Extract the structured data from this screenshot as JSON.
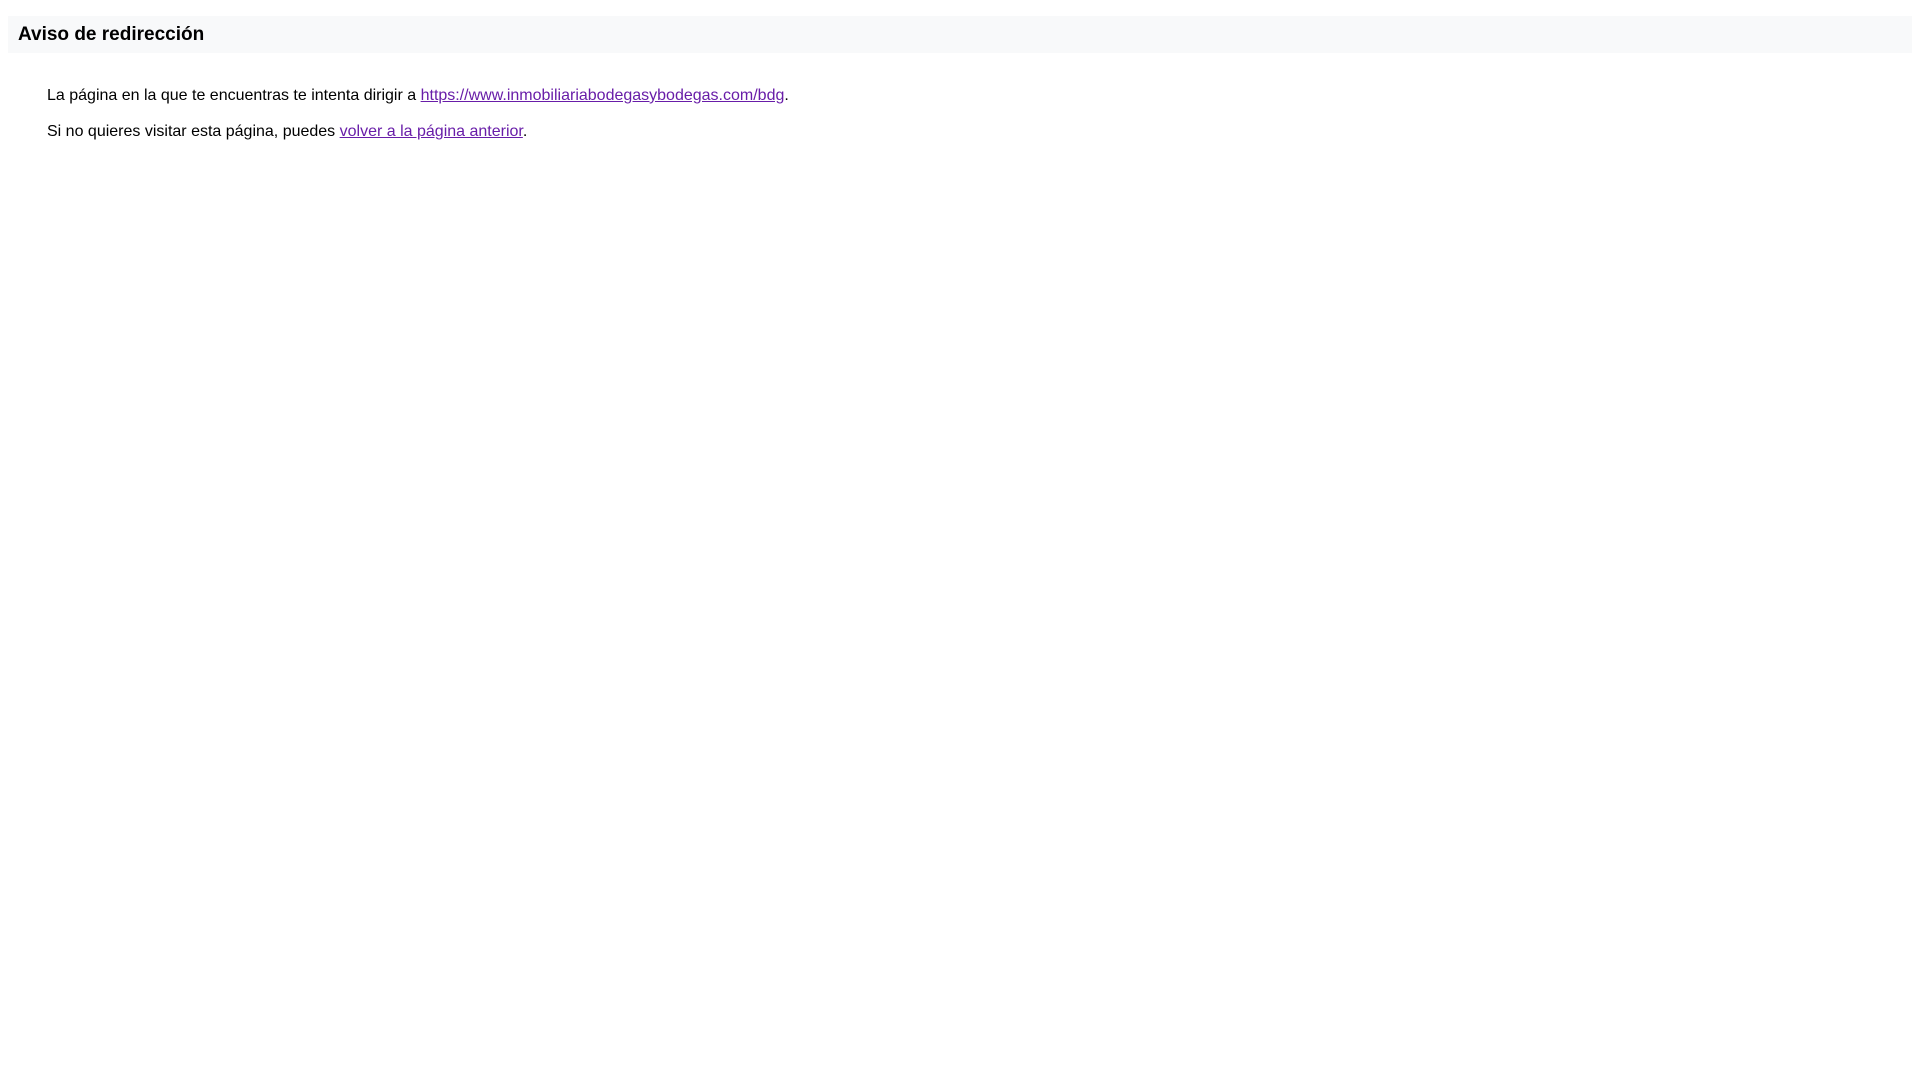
{
  "header": {
    "title": "Aviso de redirección"
  },
  "main": {
    "line1": {
      "text": "La página en la que te encuentras te intenta dirigir a ",
      "link_text": "https://www.inmobiliariabodegasybodegas.com/bdg",
      "suffix": "."
    },
    "line2": {
      "text": "Si no quieres visitar esta página, puedes ",
      "link_text": "volver a la página anterior",
      "suffix": "."
    }
  },
  "colors": {
    "header_bg": "#f8f9fa",
    "link": "#681da8"
  }
}
